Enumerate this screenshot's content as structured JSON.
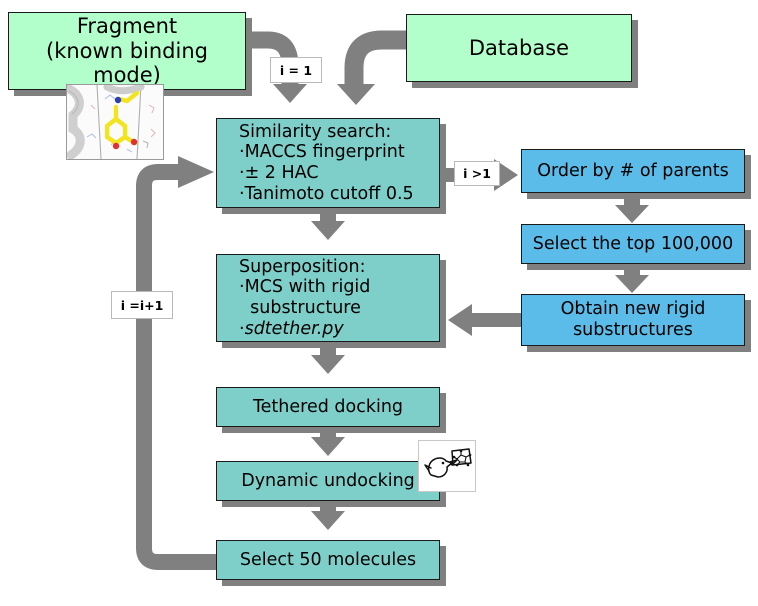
{
  "diagram": {
    "title": "Fragment growing / docking workflow",
    "colors": {
      "green_node": "#b3ffcc",
      "teal_node": "#7ecfc9",
      "blue_node": "#5bbce9",
      "connector_gray": "#808080",
      "shadow_gray": "#808080",
      "node_border": "#1a1a1a",
      "background": "#ffffff"
    }
  },
  "nodes": {
    "fragment": {
      "line1": "Fragment",
      "line2": "(known binding mode)"
    },
    "database": {
      "label": "Database"
    },
    "similarity_search": {
      "header": "Similarity search:",
      "bullets": [
        "MACCS fingerprint",
        "± 2 HAC",
        "Tanimoto cutoff 0.5"
      ]
    },
    "superposition": {
      "header": "Superposition:",
      "bullets": [
        "MCS with rigid",
        "  substructure",
        "sdtether.py"
      ]
    },
    "tethered_docking": {
      "label": "Tethered docking"
    },
    "dynamic_undocking": {
      "label": "Dynamic undocking"
    },
    "select_50": {
      "label": "Select 50 molecules"
    },
    "order_parents": {
      "label": "Order by # of parents"
    },
    "select_top": {
      "label": "Select the top 100,000"
    },
    "obtain_substructures": {
      "line1": "Obtain new rigid",
      "line2": "substructures"
    }
  },
  "edge_labels": {
    "init_iteration": "i = 1",
    "more_than_one": "i >1",
    "increment": "i =i+1"
  },
  "images": {
    "fragment_thumbnail": "protein-ligand-binding-site-image",
    "duck_logo": "duck-with-molecule-icon"
  }
}
